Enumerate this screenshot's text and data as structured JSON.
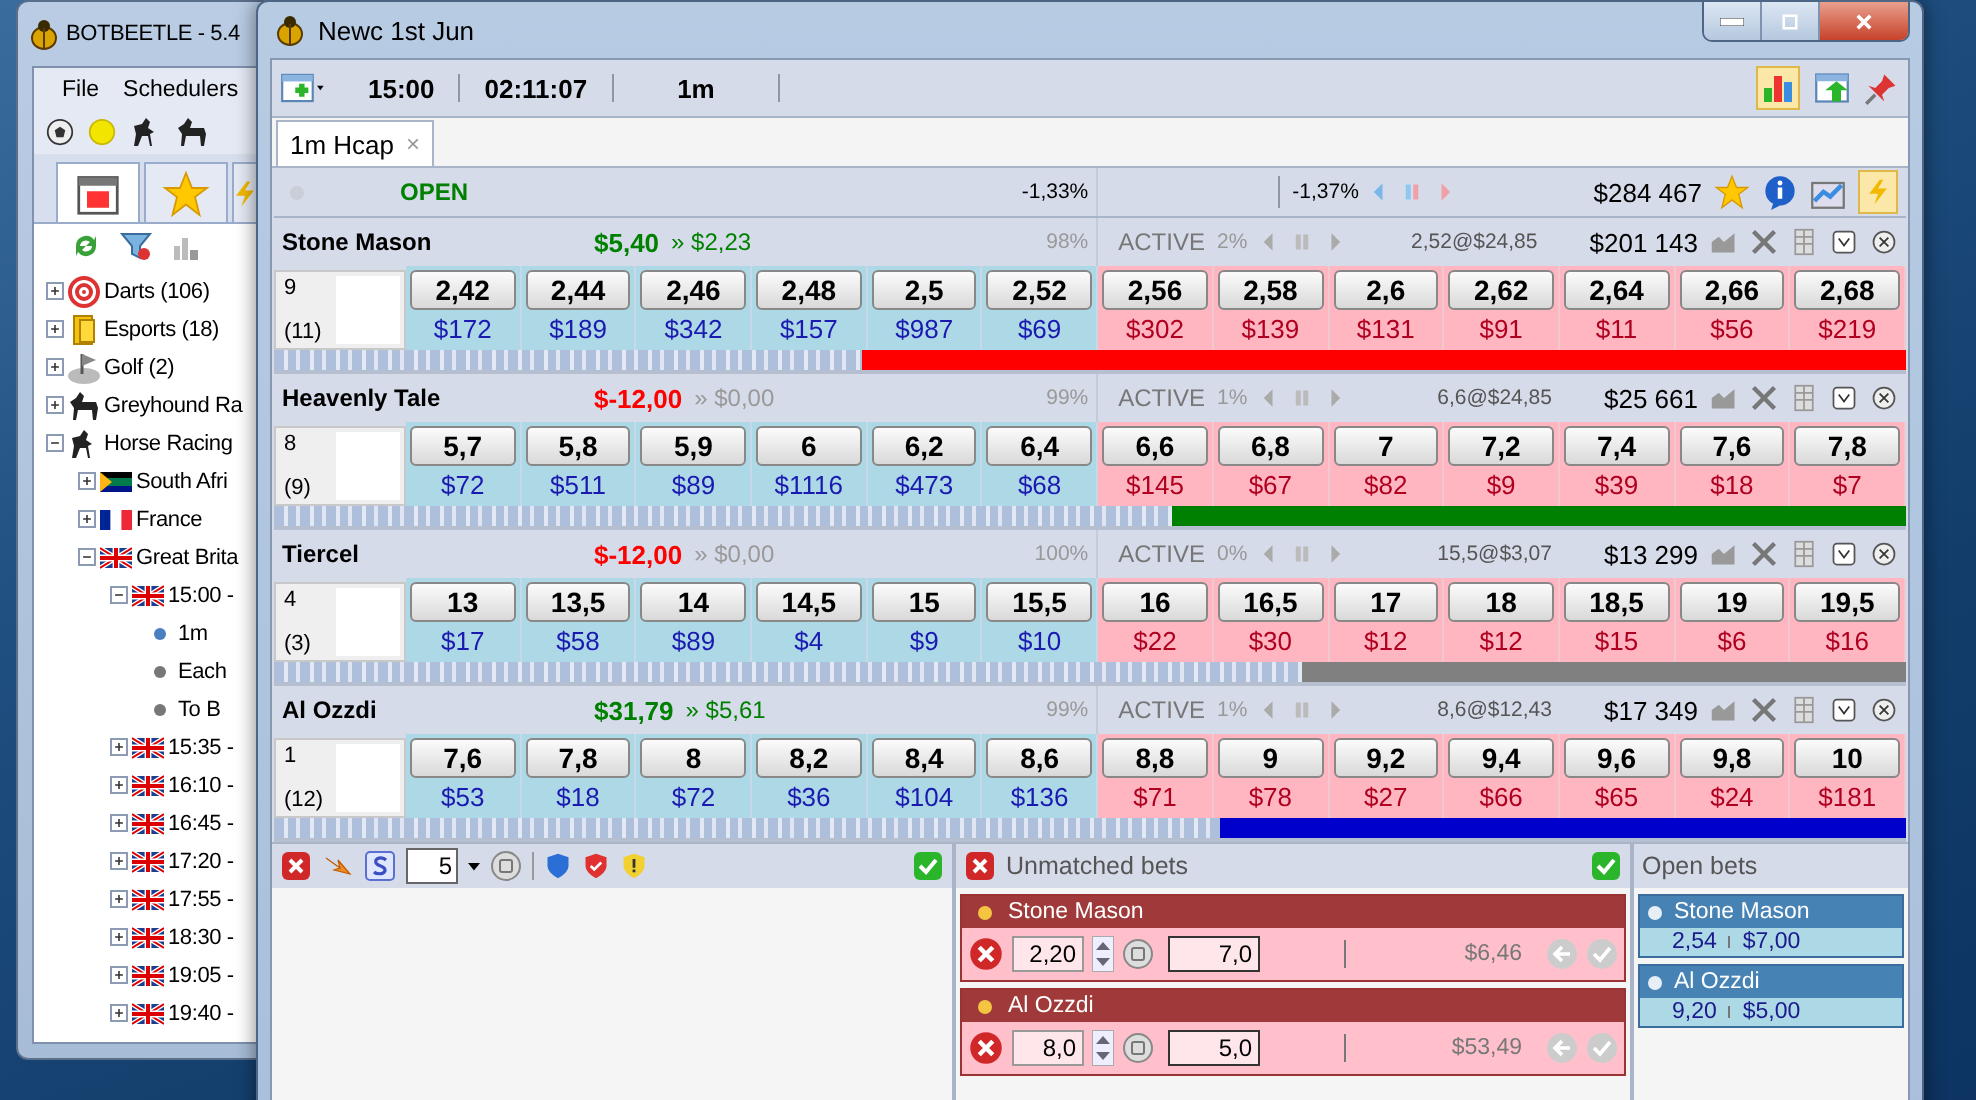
{
  "back_window": {
    "title": "BOTBEETLE - 5.4",
    "menu": [
      "File",
      "Schedulers"
    ],
    "tabs": [
      {
        "selected": true
      },
      {
        "selected": false
      },
      {
        "selected": false
      }
    ],
    "tree": [
      {
        "label": "Darts (106)",
        "expanded": false
      },
      {
        "label": "Esports (18)",
        "expanded": false
      },
      {
        "label": "Golf (2)",
        "expanded": false
      },
      {
        "label": "Greyhound Ra",
        "expanded": false
      },
      {
        "label": "Horse Racing",
        "expanded": true,
        "children": [
          {
            "label": "South Afri",
            "expanded": false
          },
          {
            "label": "France",
            "expanded": false
          },
          {
            "label": "Great Brita",
            "expanded": true,
            "children": [
              {
                "label": "15:00 -",
                "expanded": true,
                "children": [
                  {
                    "label": "1m",
                    "selected": true
                  },
                  {
                    "label": "Each",
                    "selected": false
                  },
                  {
                    "label": "To B",
                    "selected": false
                  }
                ]
              },
              {
                "label": "15:35 -",
                "expanded": false
              },
              {
                "label": "16:10 -",
                "expanded": false
              },
              {
                "label": "16:45 -",
                "expanded": false
              },
              {
                "label": "17:20 -",
                "expanded": false
              },
              {
                "label": "17:55 -",
                "expanded": false
              },
              {
                "label": "18:30 -",
                "expanded": false
              },
              {
                "label": "19:05 -",
                "expanded": false
              },
              {
                "label": "19:40 -",
                "expanded": false
              }
            ]
          }
        ]
      }
    ]
  },
  "window": {
    "title": "Newc 1st Jun"
  },
  "toolbar": {
    "time": "15:00",
    "countdown": "02:11:07",
    "distance": "1m",
    "chart_on": true
  },
  "tabs": [
    {
      "label": "1m Hcap",
      "close": "×",
      "selected": true
    }
  ],
  "market": {
    "status": "OPEN",
    "back_book": "-1,33%",
    "lay_book": "-1,37%",
    "matched": "$284 467",
    "quick_bet_on": true
  },
  "runners": [
    {
      "name": "Stone Mason",
      "profit": true,
      "pl": "$5,40",
      "pl_after": "» $2,23",
      "back_pct": "98%",
      "status": "ACTIVE",
      "lay_pct": "2%",
      "last_traded": "2,52@$24,85",
      "matched": "$201 143",
      "number": "9",
      "draw": "(11)",
      "back": [
        {
          "price": "2,42",
          "amount": "$172"
        },
        {
          "price": "2,44",
          "amount": "$189"
        },
        {
          "price": "2,46",
          "amount": "$342"
        },
        {
          "price": "2,48",
          "amount": "$157"
        },
        {
          "price": "2,5",
          "amount": "$987"
        },
        {
          "price": "2,52",
          "amount": "$69"
        }
      ],
      "lay": [
        {
          "price": "2,56",
          "amount": "$302"
        },
        {
          "price": "2,58",
          "amount": "$139"
        },
        {
          "price": "2,6",
          "amount": "$131"
        },
        {
          "price": "2,62",
          "amount": "$91"
        },
        {
          "price": "2,64",
          "amount": "$11"
        },
        {
          "price": "2,66",
          "amount": "$56"
        },
        {
          "price": "2,68",
          "amount": "$219"
        }
      ],
      "bar": {
        "color": "#ff0000",
        "level": 0.64
      }
    },
    {
      "name": "Heavenly Tale",
      "profit": false,
      "pl": "$-12,00",
      "pl_after": "» $0,00",
      "back_pct": "99%",
      "status": "ACTIVE",
      "lay_pct": "1%",
      "last_traded": "6,6@$24,85",
      "matched": "$25 661",
      "number": "8",
      "draw": "(9)",
      "back": [
        {
          "price": "5,7",
          "amount": "$72"
        },
        {
          "price": "5,8",
          "amount": "$511"
        },
        {
          "price": "5,9",
          "amount": "$89"
        },
        {
          "price": "6",
          "amount": "$1116"
        },
        {
          "price": "6,2",
          "amount": "$473"
        },
        {
          "price": "6,4",
          "amount": "$68"
        }
      ],
      "lay": [
        {
          "price": "6,6",
          "amount": "$145"
        },
        {
          "price": "6,8",
          "amount": "$67"
        },
        {
          "price": "7",
          "amount": "$82"
        },
        {
          "price": "7,2",
          "amount": "$9"
        },
        {
          "price": "7,4",
          "amount": "$39"
        },
        {
          "price": "7,6",
          "amount": "$18"
        },
        {
          "price": "7,8",
          "amount": "$7"
        }
      ],
      "bar": {
        "color": "#008000",
        "level": 0.45
      }
    },
    {
      "name": "Tiercel",
      "profit": false,
      "pl": "$-12,00",
      "pl_after": "» $0,00",
      "back_pct": "100%",
      "status": "ACTIVE",
      "lay_pct": "0%",
      "last_traded": "15,5@$3,07",
      "matched": "$13 299",
      "number": "4",
      "draw": "(3)",
      "back": [
        {
          "price": "13",
          "amount": "$17"
        },
        {
          "price": "13,5",
          "amount": "$58"
        },
        {
          "price": "14",
          "amount": "$89"
        },
        {
          "price": "14,5",
          "amount": "$4"
        },
        {
          "price": "15",
          "amount": "$9"
        },
        {
          "price": "15,5",
          "amount": "$10"
        }
      ],
      "lay": [
        {
          "price": "16",
          "amount": "$22"
        },
        {
          "price": "16,5",
          "amount": "$30"
        },
        {
          "price": "17",
          "amount": "$12"
        },
        {
          "price": "18",
          "amount": "$12"
        },
        {
          "price": "18,5",
          "amount": "$15"
        },
        {
          "price": "19",
          "amount": "$6"
        },
        {
          "price": "19,5",
          "amount": "$16"
        }
      ],
      "bar": {
        "color": "#808080",
        "level": 0.37
      }
    },
    {
      "name": "Al Ozzdi",
      "profit": true,
      "pl": "$31,79",
      "pl_after": "» $5,61",
      "back_pct": "99%",
      "status": "ACTIVE",
      "lay_pct": "1%",
      "last_traded": "8,6@$12,43",
      "matched": "$17 349",
      "number": "1",
      "draw": "(12)",
      "back": [
        {
          "price": "7,6",
          "amount": "$53"
        },
        {
          "price": "7,8",
          "amount": "$18"
        },
        {
          "price": "8",
          "amount": "$72"
        },
        {
          "price": "8,2",
          "amount": "$36"
        },
        {
          "price": "8,4",
          "amount": "$104"
        },
        {
          "price": "8,6",
          "amount": "$136"
        }
      ],
      "lay": [
        {
          "price": "8,8",
          "amount": "$71"
        },
        {
          "price": "9",
          "amount": "$78"
        },
        {
          "price": "9,2",
          "amount": "$27"
        },
        {
          "price": "9,4",
          "amount": "$66"
        },
        {
          "price": "9,6",
          "amount": "$65"
        },
        {
          "price": "9,8",
          "amount": "$24"
        },
        {
          "price": "10",
          "amount": "$181"
        }
      ],
      "bar": {
        "color": "#0000cc",
        "level": 0.42
      }
    }
  ],
  "bet_panel": {
    "stake": "5"
  },
  "unmatched": {
    "title": "Unmatched bets",
    "bets": [
      {
        "name": "Stone Mason",
        "odds": "2,20",
        "stake": "7,0",
        "liability": "$6,46"
      },
      {
        "name": "Al Ozzdi",
        "odds": "8,0",
        "stake": "5,0",
        "liability": "$53,49"
      }
    ]
  },
  "open_bets": {
    "title": "Open bets",
    "bets": [
      {
        "name": "Stone Mason",
        "odds": "2,54",
        "stake": "$7,00"
      },
      {
        "name": "Al Ozzdi",
        "odds": "9,20",
        "stake": "$5,00"
      }
    ]
  }
}
